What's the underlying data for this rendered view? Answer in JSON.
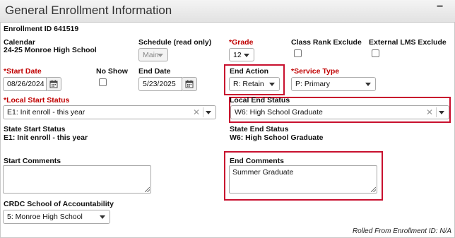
{
  "panel": {
    "title": "General Enrollment Information",
    "collapse_label": "−"
  },
  "enrollment_id": "Enrollment ID 641519",
  "calendar": {
    "label": "Calendar",
    "value": "24-25 Monroe High School"
  },
  "schedule": {
    "label": "Schedule (read only)",
    "value": "Main"
  },
  "grade": {
    "label": "Grade",
    "required_mark": "*",
    "value": "12"
  },
  "class_rank_exclude": {
    "label": "Class Rank Exclude",
    "checked": false
  },
  "external_lms_exclude": {
    "label": "External LMS Exclude",
    "checked": false
  },
  "start_date": {
    "label": "Start Date",
    "required_mark": "*",
    "value": "08/26/2024"
  },
  "no_show": {
    "label": "No Show",
    "checked": false
  },
  "end_date": {
    "label": "End Date",
    "value": "5/23/2025"
  },
  "end_action": {
    "label": "End Action",
    "value": "R: Retain"
  },
  "service_type": {
    "label": "Service Type",
    "required_mark": "*",
    "value": "P: Primary"
  },
  "local_start_status": {
    "label": "Local Start Status",
    "required_mark": "*",
    "value": "E1: Init enroll - this year",
    "clear": "✕"
  },
  "local_end_status": {
    "label": "Local End Status",
    "value": "W6: High School Graduate",
    "clear": "✕"
  },
  "state_start_status": {
    "label": "State Start Status",
    "value": "E1: Init enroll - this year"
  },
  "state_end_status": {
    "label": "State End Status",
    "value": "W6: High School Graduate"
  },
  "start_comments": {
    "label": "Start Comments",
    "value": ""
  },
  "end_comments": {
    "label": "End Comments",
    "value": "Summer Graduate"
  },
  "crdc_school": {
    "label": "CRDC School of Accountability",
    "value": "5: Monroe High School"
  },
  "footer": {
    "rolled_from": "Rolled From Enrollment ID: N/A"
  },
  "highlight_color": "#c8102e",
  "icons": [
    "calendar-icon",
    "clear-icon",
    "chevron-down-icon",
    "resize-grip-icon"
  ]
}
